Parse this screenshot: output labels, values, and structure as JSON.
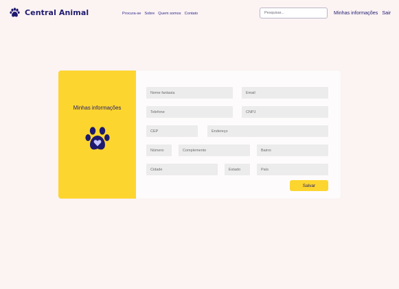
{
  "brand": {
    "name": "Central Animal",
    "icon": "paw-icon"
  },
  "nav": {
    "items": [
      {
        "label": "Procura-se"
      },
      {
        "label": "Sobre"
      },
      {
        "label": "Quem somos"
      },
      {
        "label": "Contato"
      }
    ]
  },
  "search": {
    "placeholder": "Pesquisar..."
  },
  "user_menu": {
    "info_label": "Minhas informações",
    "logout_label": "Sair"
  },
  "panel": {
    "title": "Minhas informações",
    "icon": "paw-heart-icon"
  },
  "form": {
    "nome_fantasia": "Nome fantasia",
    "email": "Email",
    "telefone": "Telefone",
    "cnpj": "CNPJ",
    "cep": "CEP",
    "endereco": "Endereço",
    "numero": "Número",
    "complemento": "Complemento",
    "bairro": "Bairro",
    "cidade": "Cidade",
    "estado": "Estado",
    "pais": "País",
    "save_label": "Salvar"
  },
  "colors": {
    "background": "#fcf3f3",
    "brand_navy": "#1e1b6e",
    "accent_yellow": "#fdd52f",
    "field_gray": "#ececec"
  }
}
